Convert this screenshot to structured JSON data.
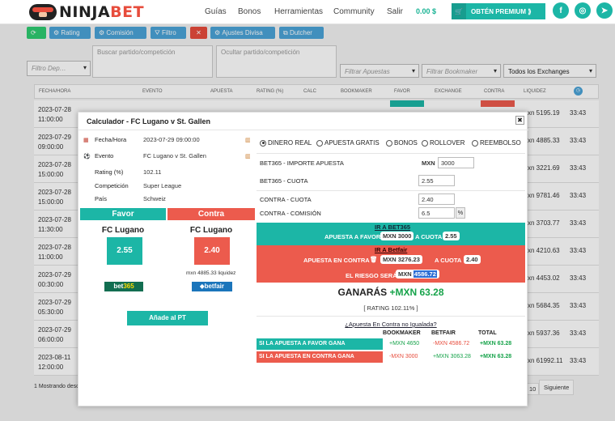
{
  "brand": {
    "name_left": "NINJA",
    "name_right": "BET"
  },
  "nav": [
    "Guías",
    "Bonos",
    "Herramientas",
    "Community",
    "Salir"
  ],
  "balance": "0.00 $",
  "premium_label": "OBTÉN PREMIUM ⟫",
  "social": [
    "f",
    "◎",
    "➤"
  ],
  "toolbar": {
    "rating": "Rating",
    "comision": "Comisión",
    "filtro": "Filtro",
    "close": "✕",
    "ajustes": "Ajustes Divisa",
    "dutcher": "Dutcher"
  },
  "filters": {
    "deporte_placeholder": "Filtro Dep…",
    "buscar_placeholder": "Buscar partido/competición",
    "ocultar_placeholder": "Ocultar partido/competición",
    "apuestas_placeholder": "Filtrar Apuestas",
    "bookmaker_placeholder": "Filtrar Bookmaker",
    "exchanges": "Todos los Exchanges"
  },
  "table": {
    "headers": [
      "FECHA/HORA",
      "EVENTO",
      "APUESTA",
      "RATING (%)",
      "CALC",
      "BOOKMAKER",
      "FAVOR",
      "EXCHANGE",
      "CONTRA",
      "LIQUIDEZ"
    ],
    "rows": [
      {
        "date": "2023-07-28",
        "time": "11:00:00",
        "liq": "xn 5195.19",
        "t": "33:43"
      },
      {
        "date": "2023-07-29",
        "time": "09:00:00",
        "liq": "xn 4885.33",
        "t": "33:43"
      },
      {
        "date": "2023-07-28",
        "time": "15:00:00",
        "liq": "xn 3221.69",
        "t": "33:43"
      },
      {
        "date": "2023-07-28",
        "time": "15:00:00",
        "liq": "xn 9781.46",
        "t": "33:43"
      },
      {
        "date": "2023-07-28",
        "time": "11:30:00",
        "liq": "xn 3703.77",
        "t": "33:43"
      },
      {
        "date": "2023-07-28",
        "time": "11:00:00",
        "liq": "xn 4210.63",
        "t": "33:43"
      },
      {
        "date": "2023-07-29",
        "time": "00:30:00",
        "liq": "xn 4453.02",
        "t": "33:43"
      },
      {
        "date": "2023-07-29",
        "time": "05:30:00",
        "liq": "xn 5684.35",
        "t": "33:43"
      },
      {
        "date": "2023-07-29",
        "time": "06:00:00",
        "liq": "xn 5937.36",
        "t": "33:43"
      },
      {
        "date": "2023-08-11",
        "time": "12:00:00",
        "liq": "xn 61992.11",
        "t": "33:43"
      }
    ],
    "footer_left": "1 Mostrando desc",
    "page_num": "10",
    "next": "Siguiente"
  },
  "modal": {
    "title": "Calculador - FC Lugano v St. Gallen",
    "close": "✖",
    "fecha_label": "Fecha/Hora",
    "fecha_value": "2023-07-29 09:00:00",
    "evento_label": "Evento",
    "evento_value": "FC Lugano v St. Gallen",
    "rating_label": "Rating (%)",
    "rating_value": "102.11",
    "comp_label": "Competición",
    "comp_value": "Super League",
    "pais_label": "País",
    "pais_value": "Schweiz",
    "favor_header": "Favor",
    "contra_header": "Contra",
    "favor_team": "FC Lugano",
    "contra_team": "FC Lugano",
    "favor_odds": "2.55",
    "contra_odds": "2.40",
    "liquidity": "mxn 4885.33 liquidez",
    "bookmaker_logo_a": "bet",
    "bookmaker_logo_b": "365",
    "exchange_logo": "⬥betfair",
    "add_pt": "Añade al PT",
    "modes": [
      "DINERO REAL",
      "APUESTA GRATIS",
      "BONOS",
      "ROLLOVER",
      "REEMBOLSO"
    ],
    "importe_label": "BET365 - IMPORTE APUESTA",
    "importe_cur": "MXN",
    "importe_value": "3000",
    "cuota_label": "BET365 - CUOTA",
    "cuota_value": "2.55",
    "contra_cuota_label": "CONTRA - CUOTA",
    "contra_cuota_value": "2.40",
    "contra_com_label": "CONTRA - COMISIÓN",
    "contra_com_value": "6.5",
    "pct": "%",
    "link_bet365": "IR A BET365",
    "favor_line_a": "APUESTA A FAVOR",
    "favor_line_amount": "MXN 3000",
    "favor_line_b": "A CUOTA",
    "favor_line_odds": "2.55",
    "link_betfair": "IR A Betfair",
    "contra_line_a": "APUESTA EN CONTRA",
    "contra_line_amount": "MXN  3276.23",
    "contra_line_b": "A CUOTA",
    "contra_line_odds": "2.40",
    "riesgo_label": "EL RIESGO SERÁ",
    "riesgo_cur": "MXN",
    "riesgo_value": "4586.72",
    "ganaras_label": "GANARÁS",
    "ganaras_value": "+MXN 63.28",
    "rating_line": "[ RATING 102.11% ]",
    "question": "¿Apuesta En Contra no Igualada?",
    "summary_headers": [
      "BOOKMAKER",
      "BETFAIR",
      "TOTAL"
    ],
    "summary_rows": [
      {
        "label": "SI LA APUESTA A FAVOR GANA",
        "bk": "+MXN 4650",
        "bf": "-MXN 4586.72",
        "total": "+MXN 63.28"
      },
      {
        "label": "SI LA APUESTA EN CONTRA GANA",
        "bk": "-MXN 3000",
        "bf": "+MXN 3063.28",
        "total": "+MXN 63.28"
      }
    ]
  },
  "colors": {
    "teal": "#1cb6a6",
    "red": "#ec5b4d",
    "green": "#16a34a"
  }
}
